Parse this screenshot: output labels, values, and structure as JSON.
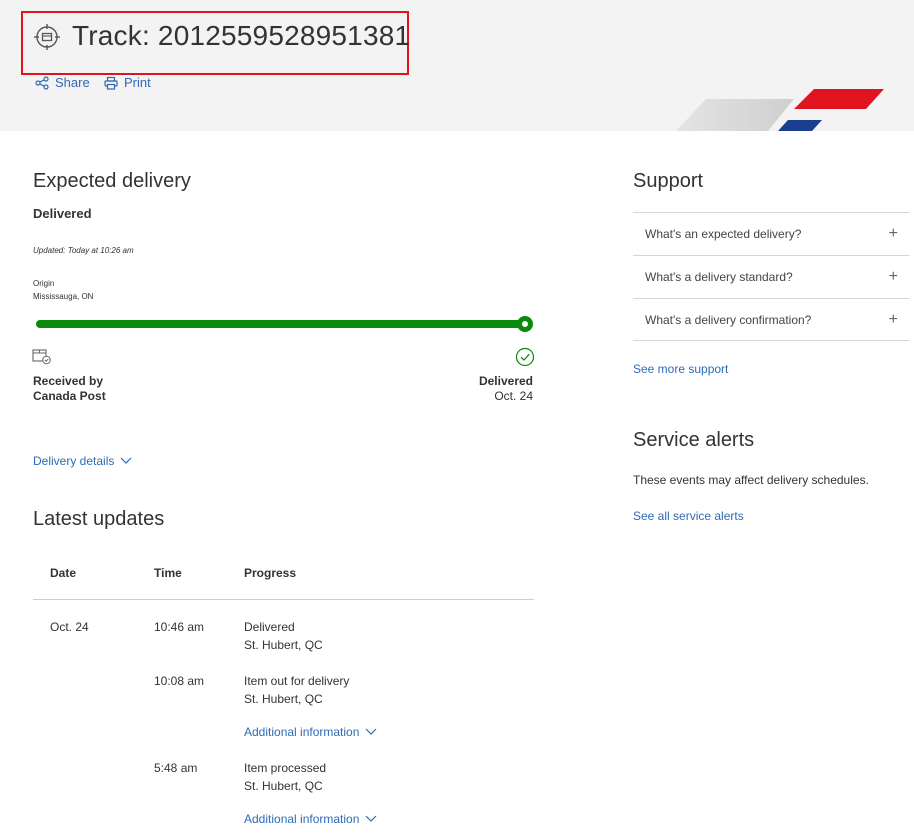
{
  "header": {
    "title": "Track: 2012559528951381",
    "share_label": "Share",
    "print_label": "Print",
    "highlight_color": "#e0141e"
  },
  "expected": {
    "heading": "Expected delivery",
    "status": "Delivered",
    "updated": "Updated: Today at 10:26 am",
    "origin_label": "Origin",
    "origin_value": "Mississauga, ON",
    "progress": 1.0,
    "start_label_line1": "Received by",
    "start_label_line2": "Canada Post",
    "end_label": "Delivered",
    "end_date": "Oct. 24",
    "details_link": "Delivery details",
    "progress_color": "#0a8a0a"
  },
  "updates": {
    "heading": "Latest updates",
    "columns": [
      "Date",
      "Time",
      "Progress"
    ],
    "rows": [
      {
        "date": "Oct. 24",
        "time": "10:46 am",
        "event": "Delivered",
        "location": "St. Hubert, QC",
        "more": ""
      },
      {
        "date": "",
        "time": "10:08 am",
        "event": "Item out for delivery",
        "location": "St. Hubert, QC",
        "more": "Additional information"
      },
      {
        "date": "",
        "time": "5:48 am",
        "event": "Item processed",
        "location": "St. Hubert, QC",
        "more": "Additional information"
      }
    ]
  },
  "support": {
    "heading": "Support",
    "items": [
      {
        "label": "What's an expected delivery?",
        "icon": "plus-icon"
      },
      {
        "label": "What's a delivery standard?",
        "icon": "plus-icon"
      },
      {
        "label": "What's a delivery confirmation?",
        "icon": "plus-icon"
      }
    ],
    "more_link": "See more support"
  },
  "alerts": {
    "heading": "Service alerts",
    "text": "These events may affect delivery schedules.",
    "link": "See all service alerts"
  },
  "colors": {
    "link": "#2f6bb5",
    "brand_red": "#e0141e",
    "brand_blue": "#1b3f8f"
  }
}
